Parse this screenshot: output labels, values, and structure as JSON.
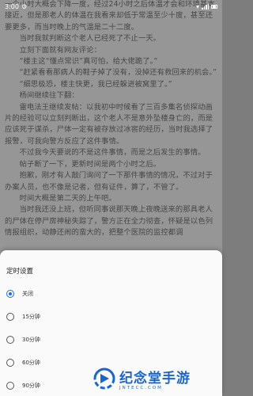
{
  "status_bar": {
    "time": "3:00"
  },
  "reader": {
    "paragraphs": [
      "一个小时大概会下降一度，经过24小时之后体温才会和环境基本接近，但是那老人的体温在我看来却低于常温至少十度，甚至还要更多，而当时晚上的气温是二十二度。",
      "当时我就判断这个老人已经死了不止一天。",
      "立刻下面就有网友评论：",
      "“楼主这“懂点常识”真可怕，给大佬跪了。”",
      "“赶紧看看那病人的鞋子掉了没有，没掉还有救回来的机会。”",
      "“细思极恐，楼主快更，我已经躲进被窝里了。”",
      "杨间继续往下翻：",
      "雷电法王继续发帖：以我初中时候看了三百多集名侦探动画片的经验可以立刻判断出，这个老人不是意外坠楼身亡的，而是应该死于谋杀，尸体一定有被存放过冰窖的经历，当时我选择了报警，可我向警方反应了这件事情。",
      "不过我今天要说的不是这件事情，而是之后发生的事情。",
      "帖子断了一下，更新时间是两个小时之后。",
      "抱歉，刚才有人敲门询问了一下那件事情的情况，不过对于办案人员，也不像是记者，但有证件，算了，不管了。",
      "时间大概是第二天的上午吧。",
      "当时我还没上班，但听同事说那天晚上夜晚送来的那具老人的尸体在停尸房神秘失踪了，警方正在全力彻查，怀疑是以色列情报组织，动静还闹的蛮大的，把整个医院的监控都调"
    ]
  },
  "sheet": {
    "title": "定时设置",
    "options": [
      {
        "label": "关闭",
        "selected": true
      },
      {
        "label": "15分钟",
        "selected": false
      },
      {
        "label": "30分钟",
        "selected": false
      },
      {
        "label": "60分钟",
        "selected": false
      },
      {
        "label": "90分钟",
        "selected": false
      }
    ]
  },
  "watermark": {
    "main": "纪念堂手游",
    "sub": "JNTECC.COM"
  },
  "colors": {
    "accent": "#1e6fe0",
    "watermark": "#1b66c9"
  }
}
